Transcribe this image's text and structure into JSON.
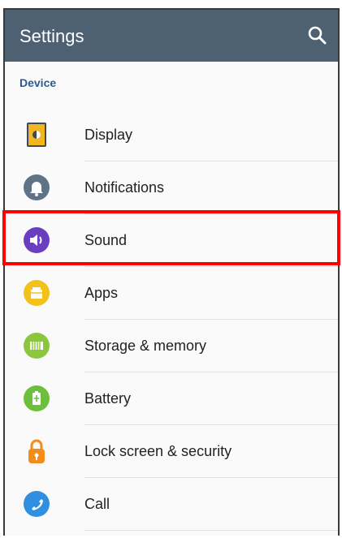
{
  "header": {
    "title": "Settings",
    "search_icon": "search-icon",
    "background": "#4d6172"
  },
  "section": {
    "title": "Device"
  },
  "items": [
    {
      "label": "Display",
      "icon": "display-icon",
      "color": "#f3b61c"
    },
    {
      "label": "Notifications",
      "icon": "bell-icon",
      "color": "#5f7387"
    },
    {
      "label": "Sound",
      "icon": "speaker-icon",
      "color": "#6a3fbf",
      "highlighted": true
    },
    {
      "label": "Apps",
      "icon": "apps-icon",
      "color": "#f2c21a"
    },
    {
      "label": "Storage & memory",
      "icon": "memory-chip-icon",
      "color": "#8cc63f"
    },
    {
      "label": "Battery",
      "icon": "battery-icon",
      "color": "#6cbf3a"
    },
    {
      "label": "Lock screen & security",
      "icon": "lock-icon",
      "color": "#f28c1a"
    },
    {
      "label": "Call",
      "icon": "phone-icon",
      "color": "#2f8fe0"
    }
  ],
  "highlight_color": "#ff0000"
}
